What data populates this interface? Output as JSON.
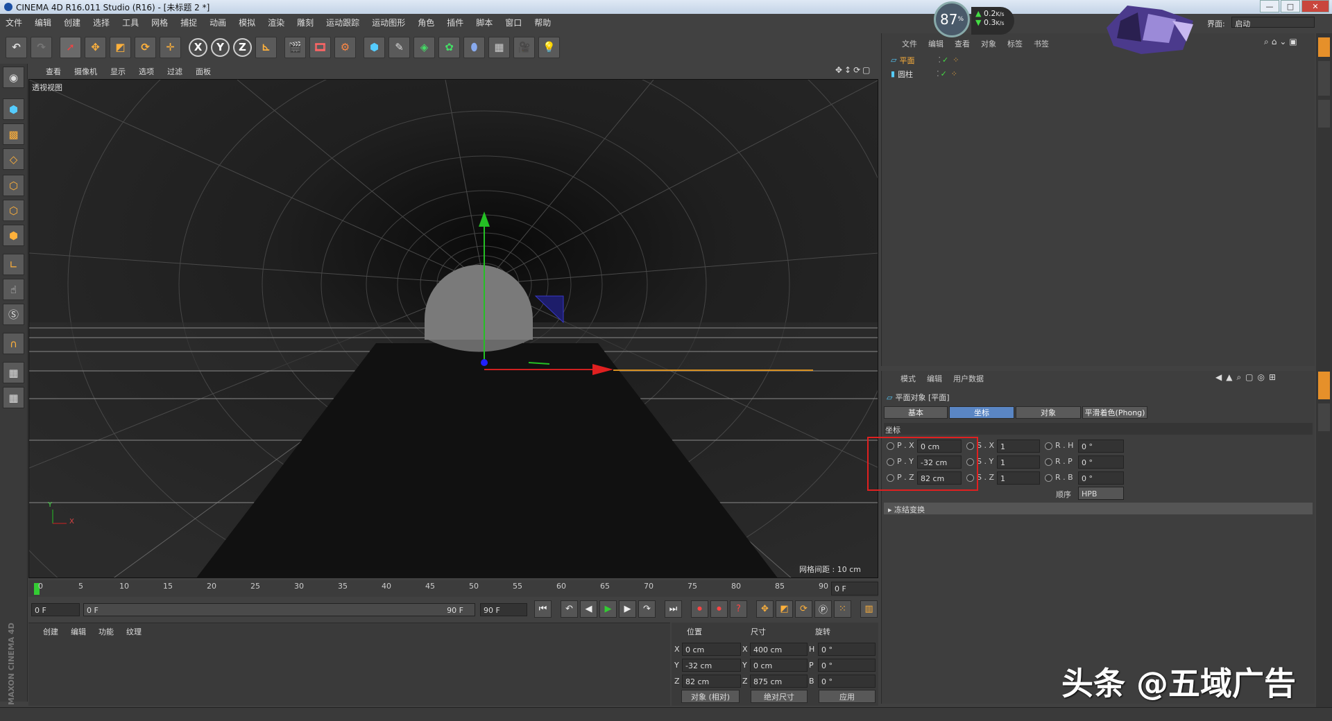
{
  "window": {
    "title": "CINEMA 4D R16.011 Studio (R16) - [未标题 2 *]",
    "min": "—",
    "max": "□",
    "close": "✕"
  },
  "menu": [
    "文件",
    "编辑",
    "创建",
    "选择",
    "工具",
    "网格",
    "捕捉",
    "动画",
    "模拟",
    "渲染",
    "雕刻",
    "运动跟踪",
    "运动图形",
    "角色",
    "插件",
    "脚本",
    "窗口",
    "帮助"
  ],
  "toolbar": {
    "axis_x": "X",
    "axis_y": "Y",
    "axis_z": "Z"
  },
  "viewport": {
    "menu": [
      "查看",
      "摄像机",
      "显示",
      "选项",
      "过滤",
      "面板"
    ],
    "label": "透视视图",
    "grid_info": "网格间距 : 10 cm",
    "axis_y": "Y",
    "axis_x": "X"
  },
  "timeline": {
    "ticks": [
      "0",
      "5",
      "10",
      "15",
      "20",
      "25",
      "30",
      "35",
      "40",
      "45",
      "50",
      "55",
      "60",
      "65",
      "70",
      "75",
      "80",
      "85",
      "90"
    ],
    "current": "0 F"
  },
  "transport": {
    "start": "0 F",
    "range_start": "0 F",
    "range_end": "90 F",
    "end": "90 F"
  },
  "material_manager": {
    "menu": [
      "创建",
      "编辑",
      "功能",
      "纹理"
    ]
  },
  "coord_manager": {
    "headers": {
      "position": "位置",
      "size": "尺寸",
      "rotation": "旋转"
    },
    "rows": [
      {
        "pl": "X",
        "pv": "0 cm",
        "sl": "X",
        "sv": "400 cm",
        "rl": "H",
        "rv": "0 °"
      },
      {
        "pl": "Y",
        "pv": "-32 cm",
        "sl": "Y",
        "sv": "0 cm",
        "rl": "P",
        "rv": "0 °"
      },
      {
        "pl": "Z",
        "pv": "82 cm",
        "sl": "Z",
        "sv": "875 cm",
        "rl": "B",
        "rv": "0 °"
      }
    ],
    "mode": "对象 (相对)",
    "size_mode": "绝对尺寸",
    "apply": "应用"
  },
  "object_manager": {
    "menu": [
      "文件",
      "编辑",
      "查看",
      "对象",
      "标签",
      "书签"
    ],
    "objects": [
      "平面",
      "圆柱"
    ]
  },
  "attr_manager": {
    "menu": [
      "模式",
      "编辑",
      "用户数据"
    ],
    "title": "平面对象 [平面]",
    "tabs": [
      "基本",
      "坐标",
      "对象",
      "平滑着色(Phong)"
    ],
    "section": "坐标",
    "fields": [
      {
        "pl": "P . X",
        "pv": "0 cm",
        "sl": "S . X",
        "sv": "1",
        "rl": "R . H",
        "rv": "0 °"
      },
      {
        "pl": "P . Y",
        "pv": "-32 cm",
        "sl": "S . Y",
        "sv": "1",
        "rl": "R . P",
        "rv": "0 °"
      },
      {
        "pl": "P . Z",
        "pv": "82 cm",
        "sl": "S . Z",
        "sv": "1",
        "rl": "R . B",
        "rv": "0 °"
      }
    ],
    "order_label": "顺序",
    "order_value": "HPB",
    "freeze": "冻结变换"
  },
  "hud": {
    "percent": "87",
    "unit": "%",
    "up": "0.2",
    "down": "0.3",
    "rate_unit": "K/s"
  },
  "layout": {
    "label": "界面:",
    "value": "启动"
  },
  "watermark": "头条 @五域广告",
  "maxon": "MAXON CINEMA 4D"
}
